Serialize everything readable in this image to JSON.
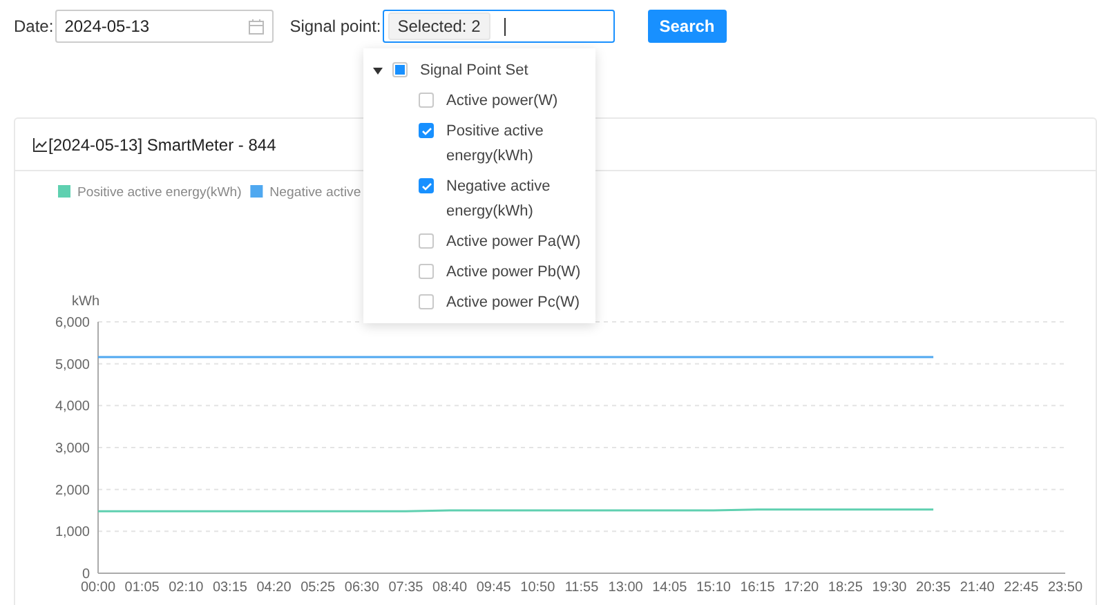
{
  "filters": {
    "date_label": "Date:",
    "date_value": "2024-05-13",
    "signal_label": "Signal point:",
    "signal_tag": "Selected: 2",
    "search_button": "Search"
  },
  "signal_dropdown": {
    "root": {
      "label": "Signal Point Set",
      "expanded": true,
      "checked": false,
      "indeterminate": true,
      "children": [
        {
          "label": "Active power(W)",
          "checked": false
        },
        {
          "label": "Positive active energy(kWh)",
          "checked": true
        },
        {
          "label": "Negative active energy(kWh)",
          "checked": true
        },
        {
          "label": "Active power Pa(W)",
          "checked": false
        },
        {
          "label": "Active power Pb(W)",
          "checked": false
        },
        {
          "label": "Active power Pc(W)",
          "checked": false
        }
      ]
    }
  },
  "chart_card": {
    "title": "[2024-05-13] SmartMeter - 844",
    "chart_data": {
      "type": "line",
      "ylabel": "kWh",
      "grid": true,
      "legend": "top",
      "x": [
        "00:00",
        "01:05",
        "02:10",
        "03:15",
        "04:20",
        "05:25",
        "06:30",
        "07:35",
        "08:40",
        "09:45",
        "10:50",
        "11:55",
        "13:00",
        "14:05",
        "15:10",
        "16:15",
        "17:20",
        "18:25",
        "19:30",
        "20:35",
        "21:40",
        "22:45",
        "23:50"
      ],
      "series": [
        {
          "name": "Positive active energy(kWh)",
          "color": "#5fd0b0",
          "values": [
            1480,
            1480,
            1480,
            1480,
            1480,
            1480,
            1480,
            1480,
            1500,
            1500,
            1500,
            1500,
            1500,
            1500,
            1500,
            1520,
            1520,
            1520,
            1520,
            1520,
            null,
            null,
            null
          ]
        },
        {
          "name": "Negative active",
          "color": "#4fa8f0",
          "values": [
            5160,
            5160,
            5160,
            5160,
            5160,
            5160,
            5160,
            5160,
            5160,
            5160,
            5160,
            5160,
            5160,
            5160,
            5160,
            5160,
            5160,
            5160,
            5160,
            5160,
            null,
            null,
            null
          ]
        }
      ],
      "ylim": [
        0,
        6000
      ],
      "yticks": [
        {
          "value": 0,
          "label": "0"
        },
        {
          "value": 1000,
          "label": "1,000"
        },
        {
          "value": 2000,
          "label": "2,000"
        },
        {
          "value": 3000,
          "label": "3,000"
        },
        {
          "value": 4000,
          "label": "4,000"
        },
        {
          "value": 5000,
          "label": "5,000"
        },
        {
          "value": 6000,
          "label": "6,000"
        }
      ]
    }
  }
}
